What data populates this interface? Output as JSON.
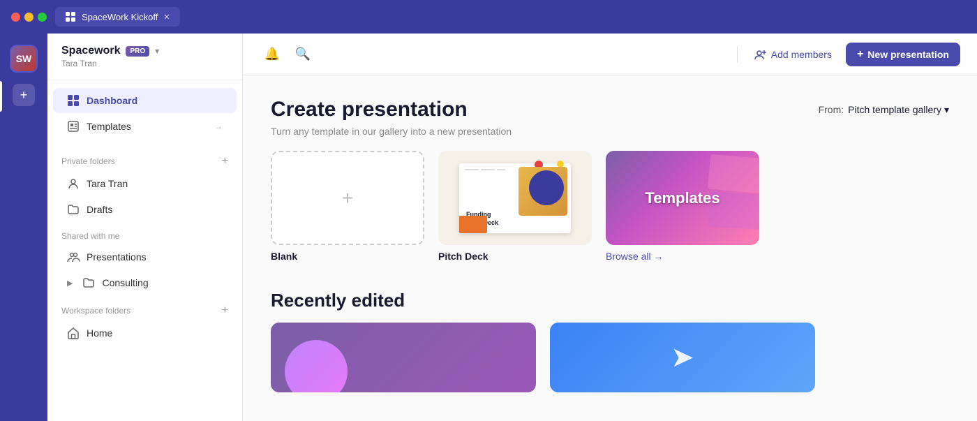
{
  "titlebar": {
    "tab_title": "SpaceWork Kickoff",
    "close_label": "✕"
  },
  "sidebar": {
    "brand": "Spacework",
    "pro_label": "PRO",
    "user_name": "Tara Tran",
    "avatar_initials": "SW",
    "nav_items": [
      {
        "id": "dashboard",
        "label": "Dashboard",
        "active": true
      },
      {
        "id": "templates",
        "label": "Templates"
      }
    ],
    "private_folders_label": "Private folders",
    "private_items": [
      {
        "id": "tara",
        "label": "Tara Tran"
      },
      {
        "id": "drafts",
        "label": "Drafts"
      }
    ],
    "shared_label": "Shared with me",
    "shared_items": [
      {
        "id": "presentations",
        "label": "Presentations"
      },
      {
        "id": "consulting",
        "label": "Consulting"
      }
    ],
    "workspace_label": "Workspace folders",
    "workspace_items": [
      {
        "id": "home",
        "label": "Home"
      }
    ]
  },
  "topbar": {
    "add_members_label": "Add members",
    "new_presentation_label": "New presentation"
  },
  "main": {
    "create_title": "Create presentation",
    "create_subtitle": "Turn any template in our gallery into a new presentation",
    "from_label": "From:",
    "gallery_label": "Pitch template gallery",
    "templates": [
      {
        "id": "blank",
        "label": "Blank"
      },
      {
        "id": "pitch",
        "label": "Pitch Deck",
        "slide_title": "Funding\nPitch Deck"
      },
      {
        "id": "gallery",
        "label": "Templates"
      }
    ],
    "browse_all_label": "Browse all →",
    "recently_edited_title": "Recently edited"
  }
}
